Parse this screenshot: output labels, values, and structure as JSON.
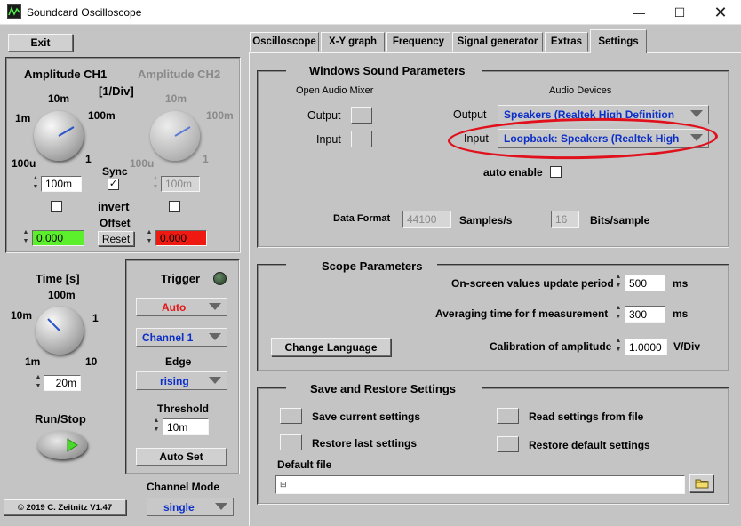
{
  "window": {
    "title": "Soundcard Oscilloscope",
    "minimize_icon": "minimize-icon",
    "maximize_icon": "maximize-icon",
    "close_icon": "close-icon"
  },
  "left": {
    "exit_label": "Exit",
    "amp_ch1_title": "Amplitude CH1",
    "amp_ch2_title": "Amplitude CH2",
    "per_div": "[1/Div]",
    "knob_labels": {
      "tick_10m": "10m",
      "tick_1m": "1m",
      "tick_100m": "100m",
      "tick_100u": "100u",
      "tick_1": "1"
    },
    "ch1_value": "100m",
    "ch2_value": "100m",
    "sync_label": "Sync",
    "sync_checked": "✓",
    "invert_label": "invert",
    "offset_label": "Offset",
    "ch1_offset": "0.000",
    "ch2_offset": "0.000",
    "reset_label": "Reset",
    "time_title": "Time [s]",
    "time_ticks": {
      "t100m": "100m",
      "t10m": "10m",
      "t1": "1",
      "t1m": "1m",
      "t10": "10"
    },
    "time_value": "20m",
    "runstop_label": "Run/Stop",
    "copyright": "© 2019  C. Zeitnitz V1.47"
  },
  "trigger": {
    "title": "Trigger",
    "mode": "Auto",
    "channel": "Channel 1",
    "edge_label": "Edge",
    "edge": "rising",
    "threshold_label": "Threshold",
    "threshold_value": "10m",
    "autoset_label": "Auto Set",
    "channel_mode_label": "Channel Mode",
    "channel_mode": "single"
  },
  "tabs": [
    "Oscilloscope",
    "X-Y graph",
    "Frequency",
    "Signal generator",
    "Extras",
    "Settings"
  ],
  "sound": {
    "title": "Windows Sound Parameters",
    "mixer_title": "Open Audio Mixer",
    "devices_title": "Audio Devices",
    "output_label": "Output",
    "input_label": "Input",
    "output_device": "Speakers (Realtek High Definition",
    "input_device": "Loopback: Speakers (Realtek High",
    "auto_enable_label": "auto enable",
    "data_format_label": "Data Format",
    "sample_rate": "44100",
    "samples_unit": "Samples/s",
    "bits": "16",
    "bits_unit": "Bits/sample",
    "highlight_color": "#e0101c"
  },
  "scope": {
    "title": "Scope Parameters",
    "update_label": "On-screen values update period",
    "update_value": "500",
    "update_unit": "ms",
    "avg_label": "Averaging time for f measurement",
    "avg_value": "300",
    "avg_unit": "ms",
    "change_language": "Change Language",
    "calib_label": "Calibration of amplitude",
    "calib_value": "1.0000",
    "calib_unit": "V/Div"
  },
  "save": {
    "title": "Save and Restore Settings",
    "save_current": "Save current settings",
    "restore_last": "Restore last settings",
    "read_file": "Read settings from file",
    "restore_default": "Restore default settings",
    "default_file_label": "Default file",
    "default_file_value": "",
    "folder_icon": "folder-icon"
  },
  "colors": {
    "offset_green": "#5cf02c",
    "offset_red": "#ee1a12",
    "link_blue": "#0c2fc8",
    "trigger_red": "#e01818"
  }
}
